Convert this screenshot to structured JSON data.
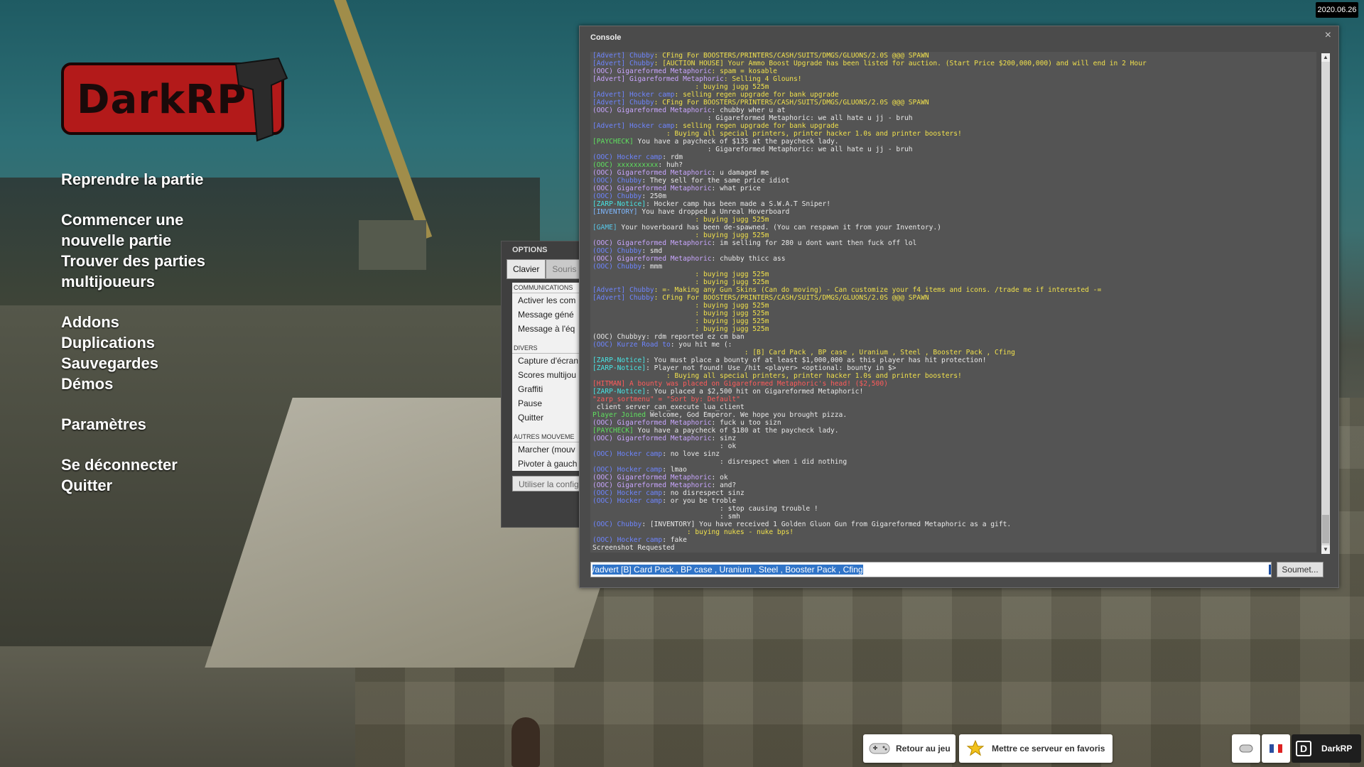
{
  "logo": {
    "text": "DarkRP"
  },
  "main_menu": {
    "resume": "Reprendre la partie",
    "new_game_1": "Commencer une",
    "new_game_2": "nouvelle partie",
    "find_games_1": "Trouver des parties",
    "find_games_2": "multijoueurs",
    "addons": "Addons",
    "duplications": "Duplications",
    "saves": "Sauvegardes",
    "demos": "Démos",
    "settings": "Paramètres",
    "disconnect": "Se déconnecter",
    "quit": "Quitter"
  },
  "options": {
    "title": "OPTIONS",
    "tabs": [
      "Clavier",
      "Souris"
    ],
    "sections": [
      {
        "header": "COMMUNICATIONS",
        "items": [
          "Activer les com",
          "Message géné",
          "Message à l'éq"
        ]
      },
      {
        "header": "DIVERS",
        "items": [
          "Capture d'écran",
          "Scores multijou",
          "Graffiti",
          "Pause",
          "Quitter"
        ]
      },
      {
        "header": "AUTRES MOUVEME",
        "items": [
          "Marcher (mouv",
          "Pivoter à gauch"
        ]
      }
    ],
    "bottom_button": "Utiliser la config"
  },
  "console": {
    "title": "Console",
    "close": "×",
    "input_value": "/advert [B] Card Pack , BP case , Uranium , Steel , Booster Pack , Cfing",
    "submit_label": "Soumet...",
    "lines": [
      [
        [
          "[Advert] Chubby",
          "adv"
        ],
        [
          ": CFing For BOOSTERS/PRINTERS/CASH/SUITS/DMGS/GLUONS/2.0S @@@ SPAWN",
          "y"
        ]
      ],
      [
        [
          "[Advert] Chubby",
          "adv"
        ],
        [
          ": [AUCTION HOUSE] Your Ammo Boost Upgrade has been listed for auction. (Start Price $200,000,000) and will end in 2 Hour",
          "y"
        ]
      ],
      [
        [
          "(OOC) Gigareformed Metaphoric",
          "ooc"
        ],
        [
          ": spam = kosable",
          "y"
        ]
      ],
      [
        [
          "[Advert] Gigareformed Metaphoric",
          "ooc"
        ],
        [
          ": Selling 4 Glouns!",
          "y"
        ]
      ],
      [
        [
          "                         : buying jugg 525m",
          "y"
        ]
      ],
      [
        [
          "[Advert] Hocker camp",
          "adv"
        ],
        [
          ": selling regen upgrade for bank upgrade",
          "y"
        ]
      ],
      [
        [
          "[Advert] Chubby",
          "adv"
        ],
        [
          ": CFing For BOOSTERS/PRINTERS/CASH/SUITS/DMGS/GLUONS/2.0S @@@ SPAWN",
          "y"
        ]
      ],
      [
        [
          "(OOC) Gigareformed Metaphoric",
          "ooc"
        ],
        [
          ": chubby wher u at",
          "w"
        ]
      ],
      [
        [
          "                            : Gigareformed Metaphoric: we all hate u jj - bruh",
          "w"
        ]
      ],
      [
        [
          "[Advert] Hocker camp",
          "adv"
        ],
        [
          ": selling regen upgrade for bank upgrade",
          "y"
        ]
      ],
      [
        [
          "                  : Buying all special printers, printer hacker 1.0s and printer boosters!",
          "y"
        ]
      ],
      [
        [
          "[PAYCHECK]",
          "grn"
        ],
        [
          " You have a paycheck of $135 at the paycheck lady.",
          "w"
        ]
      ],
      [
        [
          "                            : Gigareformed Metaphoric: we all hate u jj - bruh",
          "w"
        ]
      ],
      [
        [
          "(OOC) Hocker camp",
          "name"
        ],
        [
          ": rdm",
          "w"
        ]
      ],
      [
        [
          "(OOC) xxxxxxxxxx",
          "grn"
        ],
        [
          ": huh?",
          "w"
        ]
      ],
      [
        [
          "(OOC) Gigareformed Metaphoric",
          "ooc"
        ],
        [
          ": u damaged me",
          "w"
        ]
      ],
      [
        [
          "(OOC) Chubby",
          "name"
        ],
        [
          ": They sell for the same price idiot",
          "w"
        ]
      ],
      [
        [
          "(OOC) Gigareformed Metaphoric",
          "ooc"
        ],
        [
          ": what price",
          "w"
        ]
      ],
      [
        [
          "(OOC) Chubby",
          "name"
        ],
        [
          ": 250m",
          "w"
        ]
      ],
      [
        [
          "[ZARP-Notice]",
          "zarp"
        ],
        [
          ": Hocker camp has been made a S.W.A.T Sniper!",
          "w"
        ]
      ],
      [
        [
          "[INVENTORY]",
          "inv"
        ],
        [
          " You have dropped a Unreal Hoverboard",
          "w"
        ]
      ],
      [
        [
          "                         : buying jugg 525m",
          "y"
        ]
      ],
      [
        [
          "[GAME]",
          "cyan"
        ],
        [
          " Your hoverboard has been de-spawned. (You can respawn it from your Inventory.)",
          "w"
        ]
      ],
      [
        [
          "                         : buying jugg 525m",
          "y"
        ]
      ],
      [
        [
          "(OOC) Gigareformed Metaphoric",
          "ooc"
        ],
        [
          ": im selling for 280 u dont want then fuck off lol",
          "w"
        ]
      ],
      [
        [
          "(OOC) Chubby",
          "name"
        ],
        [
          ": smd",
          "w"
        ]
      ],
      [
        [
          "(OOC) Gigareformed Metaphoric",
          "ooc"
        ],
        [
          ": chubby thicc ass",
          "w"
        ]
      ],
      [
        [
          "(OOC) Chubby",
          "name"
        ],
        [
          ": mmm",
          "w"
        ]
      ],
      [
        [
          "",
          "w"
        ]
      ],
      [
        [
          "                         : buying jugg 525m",
          "y"
        ]
      ],
      [
        [
          "                         : buying jugg 525m",
          "y"
        ]
      ],
      [
        [
          "[Advert] Chubby",
          "adv"
        ],
        [
          ": =- Making any Gun Skins (Can do moving) - Can customize your f4 items and icons. /trade me if interested -=",
          "y"
        ]
      ],
      [
        [
          "[Advert] Chubby",
          "adv"
        ],
        [
          ": CFing For BOOSTERS/PRINTERS/CASH/SUITS/DMGS/GLUONS/2.0S @@@ SPAWN",
          "y"
        ]
      ],
      [
        [
          "                         : buying jugg 525m",
          "y"
        ]
      ],
      [
        [
          "                         : buying jugg 525m",
          "y"
        ]
      ],
      [
        [
          "                         : buying jugg 525m",
          "y"
        ]
      ],
      [
        [
          "                         : buying jugg 525m",
          "y"
        ]
      ],
      [
        [
          "(OOC) Chubbyy: rdm reported ez cm ban",
          "w"
        ]
      ],
      [
        [
          "(OOC) Kurze Road to",
          "name"
        ],
        [
          ": you hit me (:",
          "w"
        ]
      ],
      [
        [
          "                                     : [B] Card Pack , BP case , Uranium , Steel , Booster Pack , Cfing",
          "y"
        ]
      ],
      [
        [
          "[ZARP-Notice]",
          "zarp"
        ],
        [
          ": You must place a bounty of at least $1,000,000 as this player has hit protection!",
          "w"
        ]
      ],
      [
        [
          "[ZARP-Notice]",
          "zarp"
        ],
        [
          ": Player not found! Use /hit <player> <optional: bounty in $>",
          "w"
        ]
      ],
      [
        [
          "                  : Buying all special printers, printer hacker 1.0s and printer boosters!",
          "y"
        ]
      ],
      [
        [
          "[HITMAN] A bounty was placed on Gigareformed Metaphoric's head! ($2,500)",
          "red"
        ]
      ],
      [
        [
          "[ZARP-Notice]",
          "zarp"
        ],
        [
          ": You placed a $2,500 hit on Gigareformed Metaphoric!",
          "w"
        ]
      ],
      [
        [
          "\"zarp_sortmenu\" = \"Sort by: Default\"",
          "red"
        ]
      ],
      [
        [
          " client server_can_execute lua_client",
          "w"
        ]
      ],
      [
        [
          "Player Joined",
          "grn"
        ],
        [
          " Welcome, God Emperor. We hope you brought pizza.",
          "w"
        ]
      ],
      [
        [
          "(OOC) Gigareformed Metaphoric",
          "ooc"
        ],
        [
          ": fuck u too sizn",
          "w"
        ]
      ],
      [
        [
          "[PAYCHECK]",
          "grn"
        ],
        [
          " You have a paycheck of $180 at the paycheck lady.",
          "w"
        ]
      ],
      [
        [
          "(OOC) Gigareformed Metaphoric",
          "ooc"
        ],
        [
          ": sinz",
          "w"
        ]
      ],
      [
        [
          "                               : ok",
          "w"
        ]
      ],
      [
        [
          "(OOC) Hocker camp",
          "name"
        ],
        [
          ": no love sinz",
          "w"
        ]
      ],
      [
        [
          "                               : disrespect when i did nothing",
          "w"
        ]
      ],
      [
        [
          "(OOC) Hocker camp",
          "name"
        ],
        [
          ": lmao",
          "w"
        ]
      ],
      [
        [
          "(OOC) Gigareformed Metaphoric",
          "ooc"
        ],
        [
          ": ok",
          "w"
        ]
      ],
      [
        [
          "(OOC) Gigareformed Metaphoric",
          "ooc"
        ],
        [
          ": and?",
          "w"
        ]
      ],
      [
        [
          "(OOC) Hocker camp",
          "name"
        ],
        [
          ": no disrespect sinz",
          "w"
        ]
      ],
      [
        [
          "(OOC) Hocker camp",
          "name"
        ],
        [
          ": or you be troble",
          "w"
        ]
      ],
      [
        [
          "                               : stop causing trouble !",
          "w"
        ]
      ],
      [
        [
          "                               : smh",
          "w"
        ]
      ],
      [
        [
          "(OOC) Chubby",
          "name"
        ],
        [
          ": [INVENTORY] You have received 1 Golden Gluon Gun from Gigareformed Metaphoric as a gift.",
          "w"
        ]
      ],
      [
        [
          "                       : buying nukes - nuke bps!",
          "y"
        ]
      ],
      [
        [
          "(OOC) Hocker camp",
          "name"
        ],
        [
          ": fake",
          "w"
        ]
      ],
      [
        [
          "Screenshot Requested",
          "w"
        ]
      ]
    ]
  },
  "date_badge": "2020.06.26",
  "bottom_bar": {
    "back_to_game": "Retour au jeu",
    "favorite_server": "Mettre ce serveur en favoris",
    "darkrp": "DarkRP",
    "darkrp_letter": "D"
  }
}
